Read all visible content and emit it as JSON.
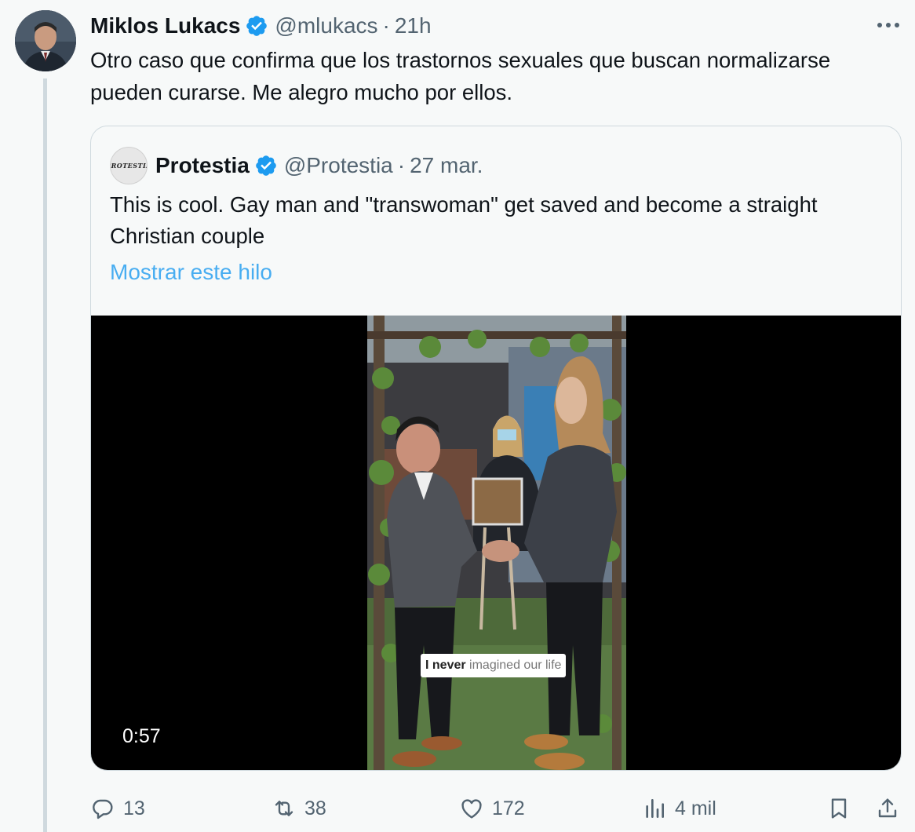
{
  "tweet": {
    "author_name": "Miklos Lukacs",
    "handle": "@mlukacs",
    "separator": "·",
    "time": "21h",
    "text": "Otro caso que confirma que los trastornos sexuales que buscan normalizarse pueden curarse. Me alegro mucho por ellos."
  },
  "quote": {
    "author_name": "Protestia",
    "handle": "@Protestia",
    "separator": "·",
    "date": "27 mar.",
    "avatar_text": "PROTESTIA",
    "text": "This is cool. Gay man and \"transwoman\" get saved and become a straight Christian couple",
    "show_thread": "Mostrar este hilo",
    "video": {
      "caption_bold": "I never",
      "caption_rest": "imagined our life",
      "duration": "0:57"
    }
  },
  "actions": {
    "replies": "13",
    "retweets": "38",
    "likes": "172",
    "views": "4 mil"
  },
  "icons": {
    "verified": "verified-badge-icon",
    "more": "more-options-icon",
    "reply": "reply-icon",
    "retweet": "retweet-icon",
    "like": "heart-icon",
    "views": "views-icon",
    "bookmark": "bookmark-icon",
    "share": "share-icon"
  },
  "colors": {
    "accent": "#1d9bf0",
    "text": "#0f1419",
    "secondary": "#536471",
    "border": "#cfd9de",
    "background": "#f7f9f9"
  }
}
